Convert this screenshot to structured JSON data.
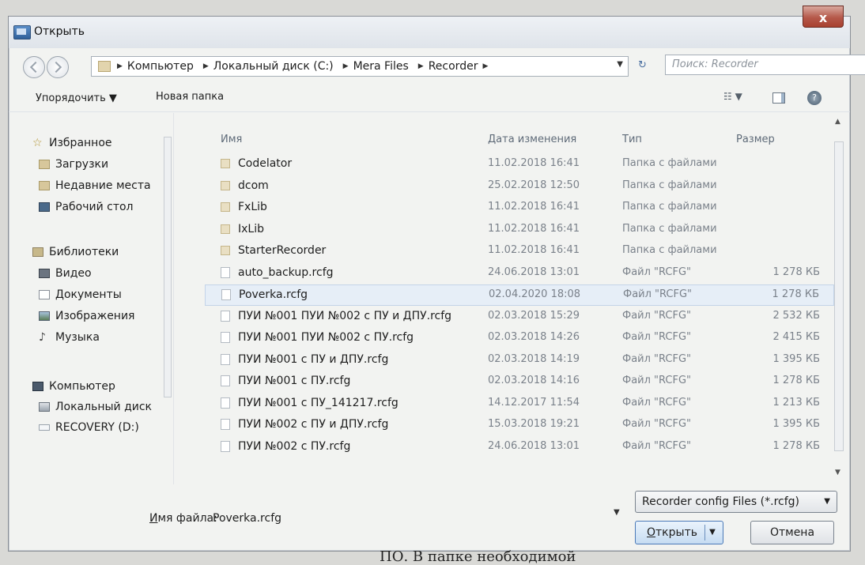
{
  "window": {
    "title": "Открыть",
    "close_label": "x"
  },
  "address": {
    "crumbs": [
      "Компьютер",
      "Локальный диск (C:)",
      "Mera Files",
      "Recorder"
    ],
    "separator": "▶",
    "dropdown": "▼",
    "refresh": "↻"
  },
  "search": {
    "placeholder": "Поиск: Recorder"
  },
  "toolbar": {
    "organize": "Упорядочить ▼",
    "new_folder": "Новая папка",
    "view": "☷ ▼",
    "help": "?"
  },
  "nav": {
    "favorites": "Избранное",
    "downloads": "Загрузки",
    "recent": "Недавние места",
    "desktop": "Рабочий стол",
    "libraries": "Библиотеки",
    "video": "Видео",
    "documents": "Документы",
    "images": "Изображения",
    "music": "Музыка",
    "computer": "Компьютер",
    "local_disk": "Локальный диск",
    "recovery": "RECOVERY (D:)"
  },
  "columns": {
    "name": "Имя",
    "date": "Дата изменения",
    "type": "Тип",
    "size": "Размер"
  },
  "files": [
    {
      "name": "Codelator",
      "date": "11.02.2018 16:41",
      "type": "Папка с файлами",
      "size": "",
      "kind": "folder"
    },
    {
      "name": "dcom",
      "date": "25.02.2018 12:50",
      "type": "Папка с файлами",
      "size": "",
      "kind": "folder"
    },
    {
      "name": "FxLib",
      "date": "11.02.2018 16:41",
      "type": "Папка с файлами",
      "size": "",
      "kind": "folder"
    },
    {
      "name": "IxLib",
      "date": "11.02.2018 16:41",
      "type": "Папка с файлами",
      "size": "",
      "kind": "folder"
    },
    {
      "name": "StarterRecorder",
      "date": "11.02.2018 16:41",
      "type": "Папка с файлами",
      "size": "",
      "kind": "folder"
    },
    {
      "name": "auto_backup.rcfg",
      "date": "24.06.2018 13:01",
      "type": "Файл \"RCFG\"",
      "size": "1 278 КБ",
      "kind": "file"
    },
    {
      "name": "Poverka.rcfg",
      "date": "02.04.2020 18:08",
      "type": "Файл \"RCFG\"",
      "size": "1 278 КБ",
      "kind": "file",
      "selected": true
    },
    {
      "name": "ПУИ №001 ПУИ №002 с ПУ и ДПУ.rcfg",
      "date": "02.03.2018 15:29",
      "type": "Файл \"RCFG\"",
      "size": "2 532 КБ",
      "kind": "file"
    },
    {
      "name": "ПУИ №001 ПУИ №002 с ПУ.rcfg",
      "date": "02.03.2018 14:26",
      "type": "Файл \"RCFG\"",
      "size": "2 415 КБ",
      "kind": "file"
    },
    {
      "name": "ПУИ №001 с ПУ и ДПУ.rcfg",
      "date": "02.03.2018 14:19",
      "type": "Файл \"RCFG\"",
      "size": "1 395 КБ",
      "kind": "file"
    },
    {
      "name": "ПУИ №001 с ПУ.rcfg",
      "date": "02.03.2018 14:16",
      "type": "Файл \"RCFG\"",
      "size": "1 278 КБ",
      "kind": "file"
    },
    {
      "name": "ПУИ №001 с ПУ_141217.rcfg",
      "date": "14.12.2017 11:54",
      "type": "Файл \"RCFG\"",
      "size": "1 213 КБ",
      "kind": "file"
    },
    {
      "name": "ПУИ №002 с ПУ и ДПУ.rcfg",
      "date": "15.03.2018 19:21",
      "type": "Файл \"RCFG\"",
      "size": "1 395 КБ",
      "kind": "file"
    },
    {
      "name": "ПУИ №002 с ПУ.rcfg",
      "date": "24.06.2018 13:01",
      "type": "Файл \"RCFG\"",
      "size": "1 278 КБ",
      "kind": "file"
    }
  ],
  "bottom": {
    "filename_label_underlined": "И",
    "filename_label_rest": "мя файла:",
    "filename_value": "Poverka.rcfg",
    "filter": "Recorder config Files (*.rcfg)",
    "open_underlined": "О",
    "open_rest": "ткрыть",
    "cancel": "Отмена"
  },
  "caption": "ПО. В папке необходимой"
}
